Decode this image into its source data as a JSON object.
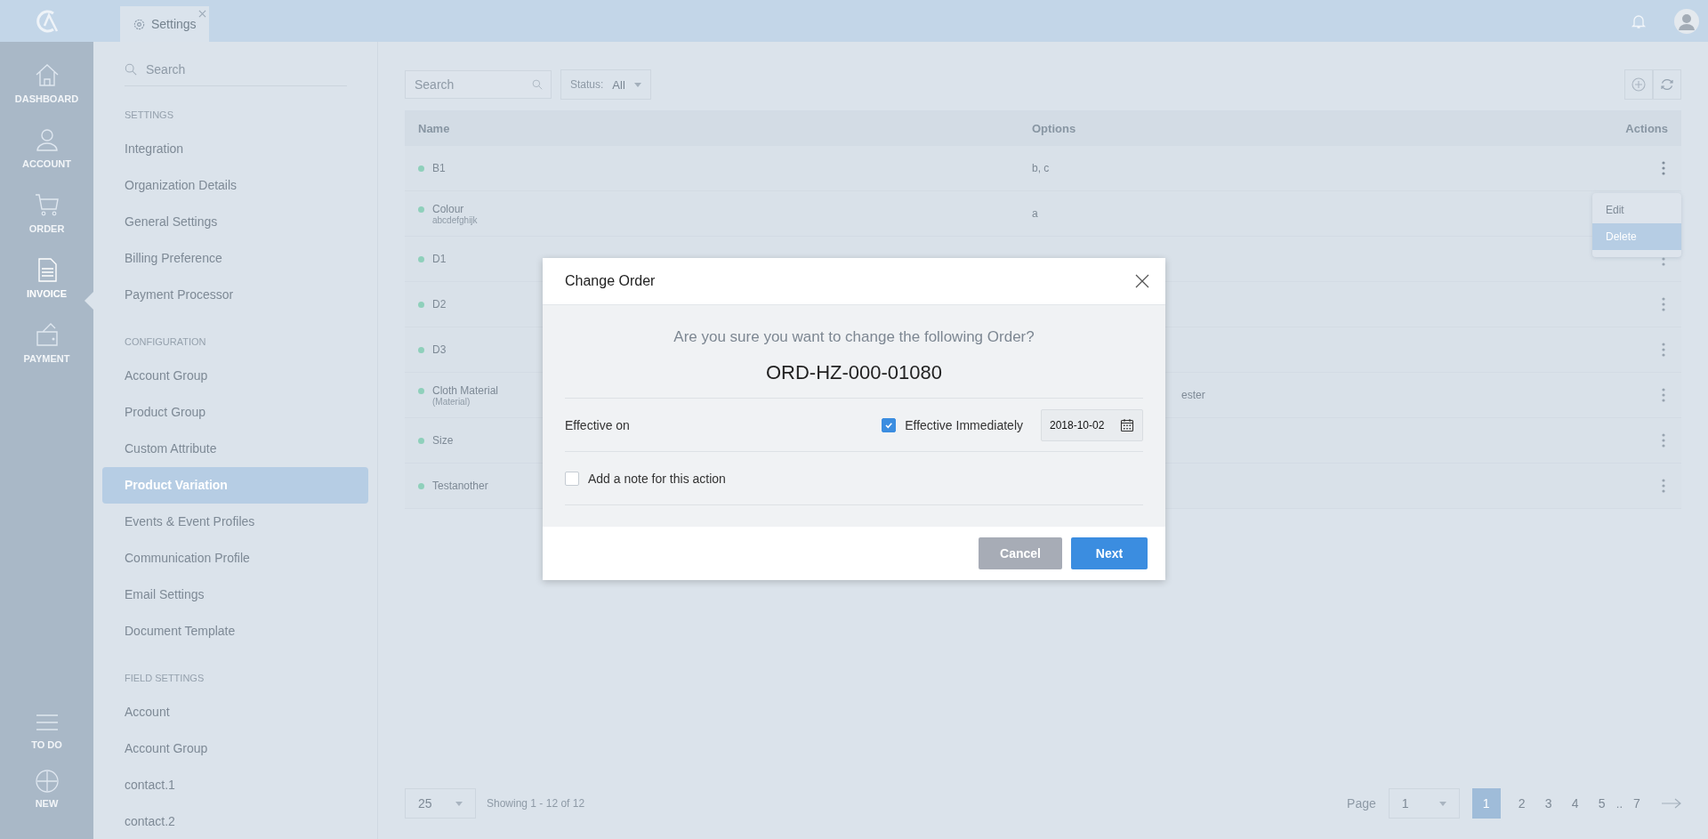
{
  "topbar": {
    "tab": {
      "label": "Settings"
    }
  },
  "nav": [
    {
      "label": "DASHBOARD",
      "selected": false
    },
    {
      "label": "ACCOUNT",
      "selected": false
    },
    {
      "label": "ORDER",
      "selected": false
    },
    {
      "label": "INVOICE",
      "selected": true
    },
    {
      "label": "PAYMENT",
      "selected": false
    }
  ],
  "nav_bottom": [
    {
      "label": "TO DO"
    },
    {
      "label": "NEW"
    }
  ],
  "sidebar": {
    "search": {
      "placeholder": "Search"
    },
    "sections": [
      {
        "heading": "SETTINGS",
        "items": [
          {
            "label": "Integration",
            "selected": false
          },
          {
            "label": "Organization Details",
            "selected": false
          },
          {
            "label": "General Settings",
            "selected": false
          },
          {
            "label": "Billing Preference",
            "selected": false
          },
          {
            "label": "Payment Processor",
            "selected": false
          }
        ]
      },
      {
        "heading": "CONFIGURATION",
        "items": [
          {
            "label": "Account Group",
            "selected": false
          },
          {
            "label": "Product Group",
            "selected": false
          },
          {
            "label": "Custom Attribute",
            "selected": false
          },
          {
            "label": "Product Variation",
            "selected": true
          },
          {
            "label": "Events & Event Profiles",
            "selected": false
          },
          {
            "label": "Communication Profile",
            "selected": false
          },
          {
            "label": "Email Settings",
            "selected": false
          },
          {
            "label": "Document Template",
            "selected": false
          }
        ]
      },
      {
        "heading": "FIELD SETTINGS",
        "items": [
          {
            "label": "Account",
            "selected": false
          },
          {
            "label": "Account Group",
            "selected": false
          },
          {
            "label": "contact.1",
            "selected": false
          },
          {
            "label": "contact.2",
            "selected": false
          }
        ]
      }
    ]
  },
  "toolbar": {
    "search": {
      "placeholder": "Search"
    },
    "status": {
      "label": "Status:",
      "value": "All"
    }
  },
  "table": {
    "columns": [
      "Name",
      "Options",
      "Actions"
    ],
    "rows": [
      {
        "name": "B1",
        "options": "b, c",
        "menu_open": true
      },
      {
        "name": "Colour",
        "subtitle": "abcdefghijk",
        "options": "a",
        "menu_open": false
      },
      {
        "name": "D1",
        "menu_open": false
      },
      {
        "name": "D2",
        "menu_open": false
      },
      {
        "name": "D3",
        "menu_open": false
      },
      {
        "name": "Cloth Material",
        "subtitle": "(Material)",
        "options_tail": "ester",
        "menu_open": false
      },
      {
        "name": "Size",
        "menu_open": false
      },
      {
        "name": "Testanother",
        "menu_open": false
      }
    ]
  },
  "row_menu": {
    "items": [
      {
        "label": "Edit",
        "selected": false
      },
      {
        "label": "Delete",
        "selected": true
      }
    ]
  },
  "pagination": {
    "page_size": "25",
    "summary": "Showing 1 - 12 of 12",
    "page_label": "Page",
    "page_input": "1",
    "pages": [
      {
        "label": "1",
        "kind": "page",
        "selected": true
      },
      {
        "label": "2",
        "kind": "page",
        "selected": false
      },
      {
        "label": "3",
        "kind": "page",
        "selected": false
      },
      {
        "label": "4",
        "kind": "page",
        "selected": false
      },
      {
        "label": "5",
        "kind": "page",
        "selected": false
      },
      {
        "label": "..",
        "kind": "gap"
      },
      {
        "label": "7",
        "kind": "page",
        "selected": false
      }
    ]
  },
  "modal": {
    "title": "Change Order",
    "question": "Are you sure you want to change the following Order?",
    "order_number": "ORD-HZ-000-01080",
    "effective_label": "Effective on",
    "immediately": {
      "label": "Effective Immediately",
      "checked": true
    },
    "date": "2018-10-02",
    "note": {
      "label": "Add a note for this action",
      "checked": false
    },
    "buttons": [
      {
        "label": "Cancel",
        "kind": "secondary"
      },
      {
        "label": "Next",
        "kind": "primary"
      }
    ]
  }
}
